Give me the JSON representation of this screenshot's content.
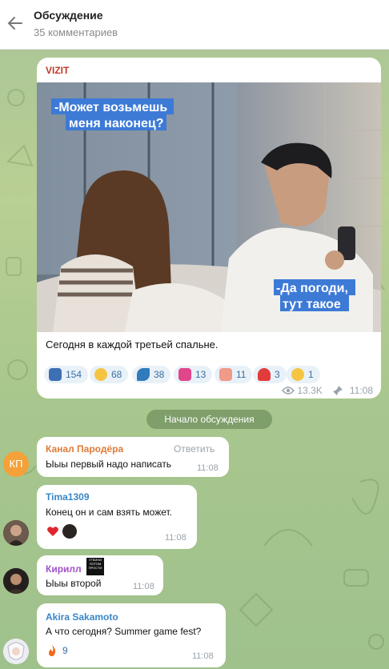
{
  "header": {
    "title": "Обсуждение",
    "subtitle": "35 комментариев"
  },
  "post": {
    "channel": "VIZIT",
    "image_caption_top": [
      "-Может возьмешь",
      "меня наконец?"
    ],
    "image_caption_bottom": [
      "-Да погоди,",
      "тут такое"
    ],
    "text": "Сегодня в каждой третьей спальне.",
    "reactions": [
      {
        "icon": "book-icon",
        "count": "154"
      },
      {
        "icon": "grin-icon",
        "count": "68"
      },
      {
        "icon": "banana-icon",
        "count": "38"
      },
      {
        "icon": "devil-icon",
        "count": "13"
      },
      {
        "icon": "peach-icon",
        "count": "11"
      },
      {
        "icon": "heart-hands-icon",
        "count": "3"
      },
      {
        "icon": "crying-icon",
        "count": "1"
      }
    ],
    "views": "13.3K",
    "time": "11:08"
  },
  "divider": {
    "label": "Начало обсуждения"
  },
  "comments": [
    {
      "author": "Канал Пародёра",
      "author_color": "#e07b39",
      "text": "Ыыы первый надо написать",
      "time": "11:08",
      "reply": "Ответить",
      "avatar_text": "КП"
    },
    {
      "author": "Tima1309",
      "author_color": "#3a86c8",
      "text": "Конец он и сам взять может.",
      "time": "11:08"
    },
    {
      "author": "Кирилл",
      "author_color": "#a052c8",
      "badge": "УТКИНИ ПОТОМ ПРОСТИ",
      "text": "Ыыы второй",
      "time": "11:08"
    },
    {
      "author": "Akira Sakamoto",
      "author_color": "#3a86c8",
      "text": "А что сегодня? Summer game fest?",
      "time": "11:08",
      "reaction": "9"
    }
  ],
  "colors": {
    "accent": "#3a86c8",
    "bg": "#a9c597"
  }
}
